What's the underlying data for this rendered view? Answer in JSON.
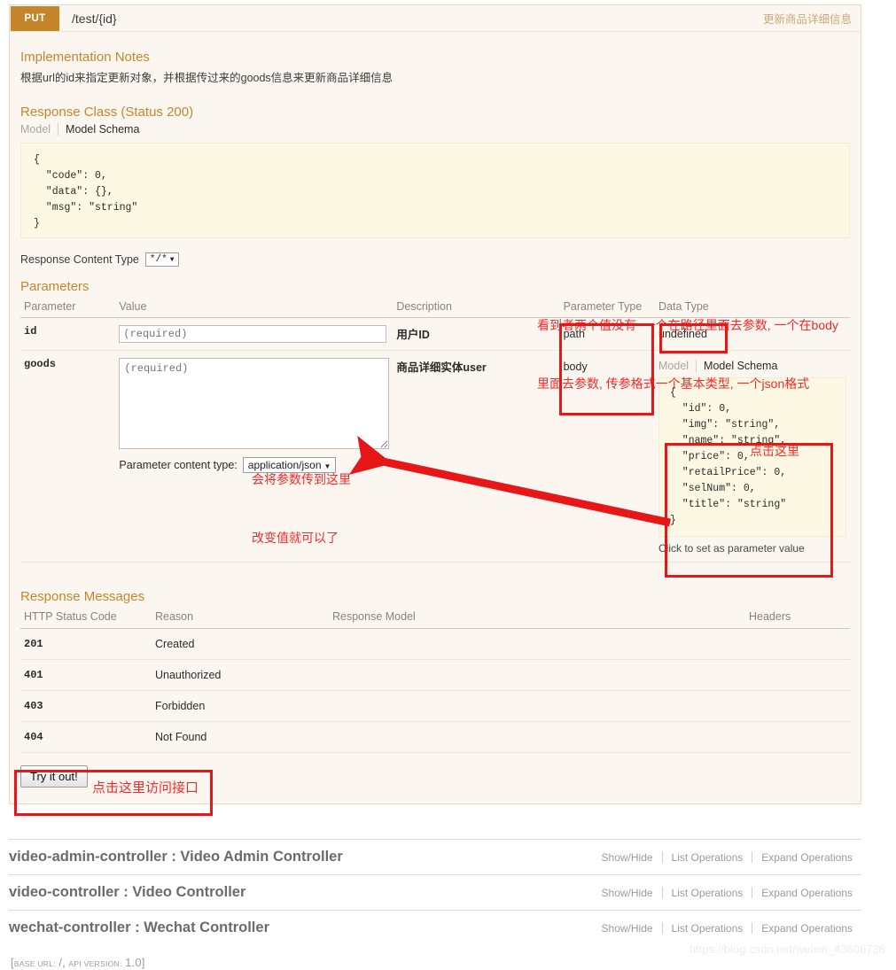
{
  "operation": {
    "method": "PUT",
    "path": "/test/{id}",
    "summary": "更新商品详细信息",
    "implementation_notes_title": "Implementation Notes",
    "implementation_notes": "根据url的id来指定更新对象，并根据传过来的goods信息来更新商品详细信息",
    "response_class_title": "Response Class (Status 200)",
    "model_tab": "Model",
    "model_schema_tab": "Model Schema",
    "response_schema": "{\n  \"code\": 0,\n  \"data\": {},\n  \"msg\": \"string\"\n}",
    "response_content_type_label": "Response Content Type",
    "response_content_type_value": "*/*"
  },
  "parameters": {
    "title": "Parameters",
    "headers": [
      "Parameter",
      "Value",
      "Description",
      "Parameter Type",
      "Data Type"
    ],
    "rows": [
      {
        "name": "id",
        "value_placeholder": "(required)",
        "description": "用户ID",
        "parameter_type": "path",
        "data_type": "undefined"
      },
      {
        "name": "goods",
        "value_placeholder": "(required)",
        "description": "商品详细实体user",
        "parameter_type": "body",
        "data_type": "",
        "content_type_label": "Parameter content type:",
        "content_type_value": "application/json",
        "model_tab": "Model",
        "model_schema_tab": "Model Schema",
        "schema": "{\n  \"id\": 0,\n  \"img\": \"string\",\n  \"name\": \"string\",\n  \"price\": 0,\n  \"retailPrice\": 0,\n  \"selNum\": 0,\n  \"title\": \"string\"\n}",
        "click_hint": "Click to set as parameter value"
      }
    ]
  },
  "response_messages": {
    "title": "Response Messages",
    "headers": [
      "HTTP Status Code",
      "Reason",
      "Response Model",
      "Headers"
    ],
    "rows": [
      {
        "code": "201",
        "reason": "Created",
        "model": "",
        "headers": ""
      },
      {
        "code": "401",
        "reason": "Unauthorized",
        "model": "",
        "headers": ""
      },
      {
        "code": "403",
        "reason": "Forbidden",
        "model": "",
        "headers": ""
      },
      {
        "code": "404",
        "reason": "Not Found",
        "model": "",
        "headers": ""
      }
    ]
  },
  "try_it_out_label": "Try it out!",
  "annotations": {
    "param_type_note_line1": "看到者两个值没有  一个在路径里面去参数, 一个在body",
    "param_type_note_line2": "里面去参数, 传参格式一个基本类型, 一个json格式",
    "textarea_note_line1": "会将参数传到这里",
    "textarea_note_line2": "改变值就可以了",
    "schema_note": "点击这里",
    "tryout_note": "点击这里访问接口"
  },
  "resources": [
    {
      "title": "video-admin-controller : Video Admin Controller",
      "links": [
        "Show/Hide",
        "List Operations",
        "Expand Operations"
      ]
    },
    {
      "title": "video-controller : Video Controller",
      "links": [
        "Show/Hide",
        "List Operations",
        "Expand Operations"
      ]
    },
    {
      "title": "wechat-controller : Wechat Controller",
      "links": [
        "Show/Hide",
        "List Operations",
        "Expand Operations"
      ]
    }
  ],
  "footer": {
    "base_url_label": "BASE URL:",
    "base_url_value": "/",
    "api_version_label": "API VERSION:",
    "api_version_value": "1.0"
  },
  "watermark": "https://blog.csdn.net/weixin_43606738",
  "colors": {
    "method_put": "#c5862b",
    "accent": "#c5862b",
    "annotation_red": "#e81717",
    "block_bg": "#fcf6f0",
    "code_bg": "#fcf8e3"
  }
}
